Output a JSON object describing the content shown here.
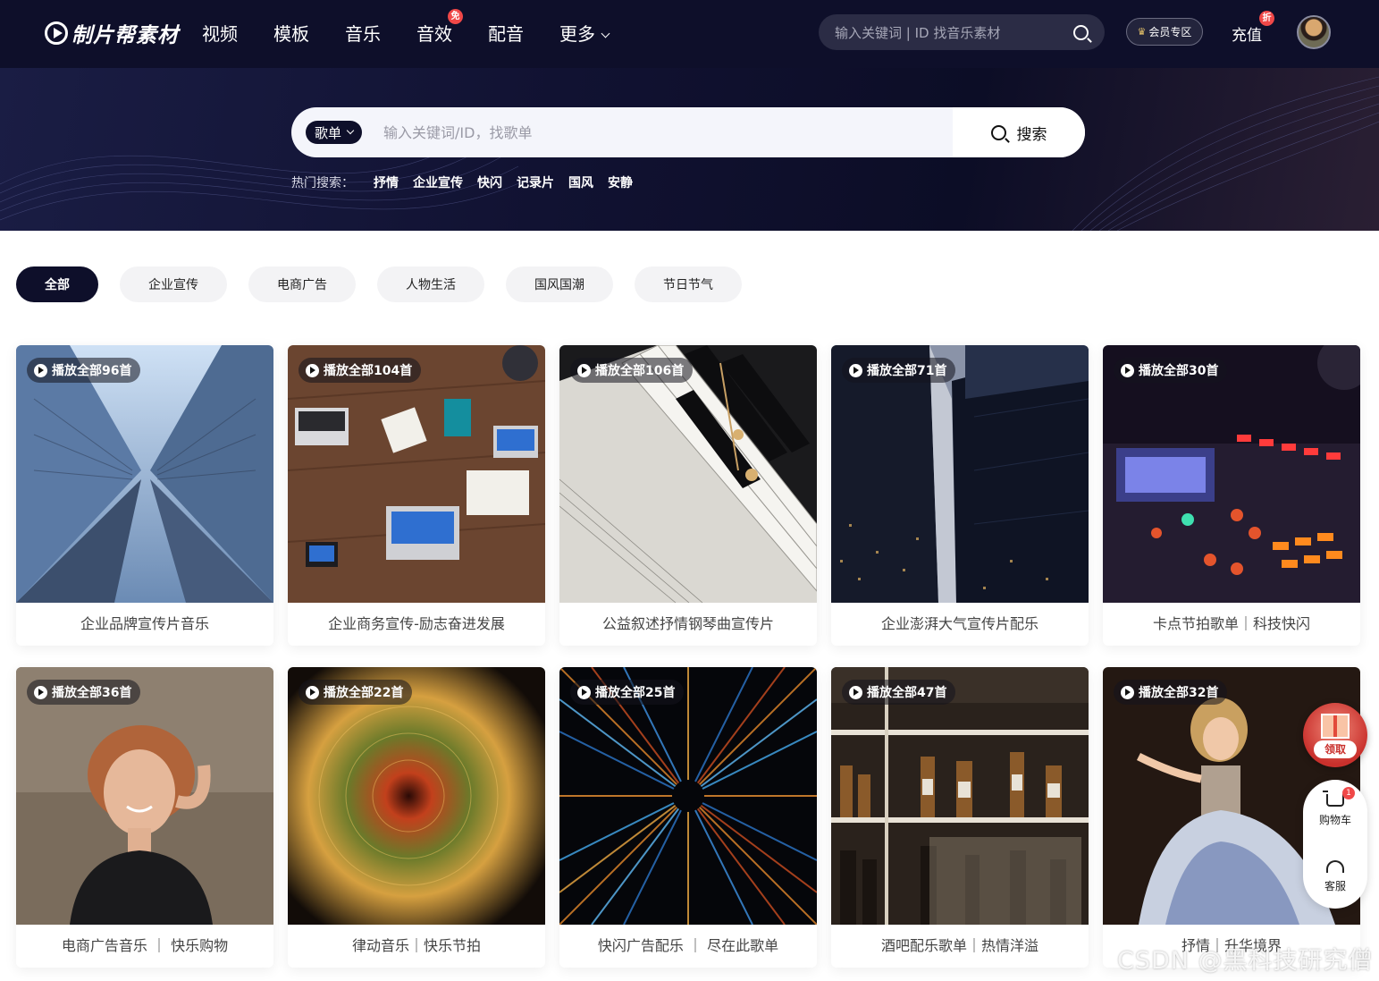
{
  "header": {
    "logo_text": "制片帮素材",
    "nav": [
      {
        "label": "视频"
      },
      {
        "label": "模板"
      },
      {
        "label": "音乐"
      },
      {
        "label": "音效",
        "badge": "免"
      },
      {
        "label": "配音"
      },
      {
        "label": "更多"
      }
    ],
    "search_placeholder": "输入关键词 | ID 找音乐素材",
    "vip_label": "会员专区",
    "recharge_label": "充值",
    "recharge_badge": "折"
  },
  "hero_search": {
    "type_label": "歌单",
    "placeholder": "输入关键词/ID，找歌单",
    "button_label": "搜索",
    "hot_label": "热门搜索：",
    "hot_tags": [
      "抒情",
      "企业宣传",
      "快闪",
      "记录片",
      "国风",
      "安静"
    ]
  },
  "categories": [
    "全部",
    "企业宣传",
    "电商广告",
    "人物生活",
    "国风国潮",
    "节日节气"
  ],
  "cards": [
    {
      "play_label": "播放全部96首",
      "title": "企业品牌宣传片音乐"
    },
    {
      "play_label": "播放全部104首",
      "title": "企业商务宣传-励志奋进发展"
    },
    {
      "play_label": "播放全部106首",
      "title": "公益叙述抒情钢琴曲宣传片"
    },
    {
      "play_label": "播放全部71首",
      "title": "企业澎湃大气宣传片配乐"
    },
    {
      "play_label": "播放全部30首",
      "title": "卡点节拍歌单｜科技快闪"
    },
    {
      "play_label": "播放全部36首",
      "title": "电商广告音乐 ｜ 快乐购物"
    },
    {
      "play_label": "播放全部22首",
      "title": "律动音乐｜快乐节拍"
    },
    {
      "play_label": "播放全部25首",
      "title": "快闪广告配乐 ｜ 尽在此歌单"
    },
    {
      "play_label": "播放全部47首",
      "title": "酒吧配乐歌单｜热情洋溢"
    },
    {
      "play_label": "播放全部32首",
      "title": "抒情｜升华境界"
    }
  ],
  "side": {
    "gift_label": "领取",
    "cart_label": "购物车",
    "cart_badge": "1",
    "service_label": "客服"
  },
  "watermark": "CSDN @黑科技研究僧"
}
